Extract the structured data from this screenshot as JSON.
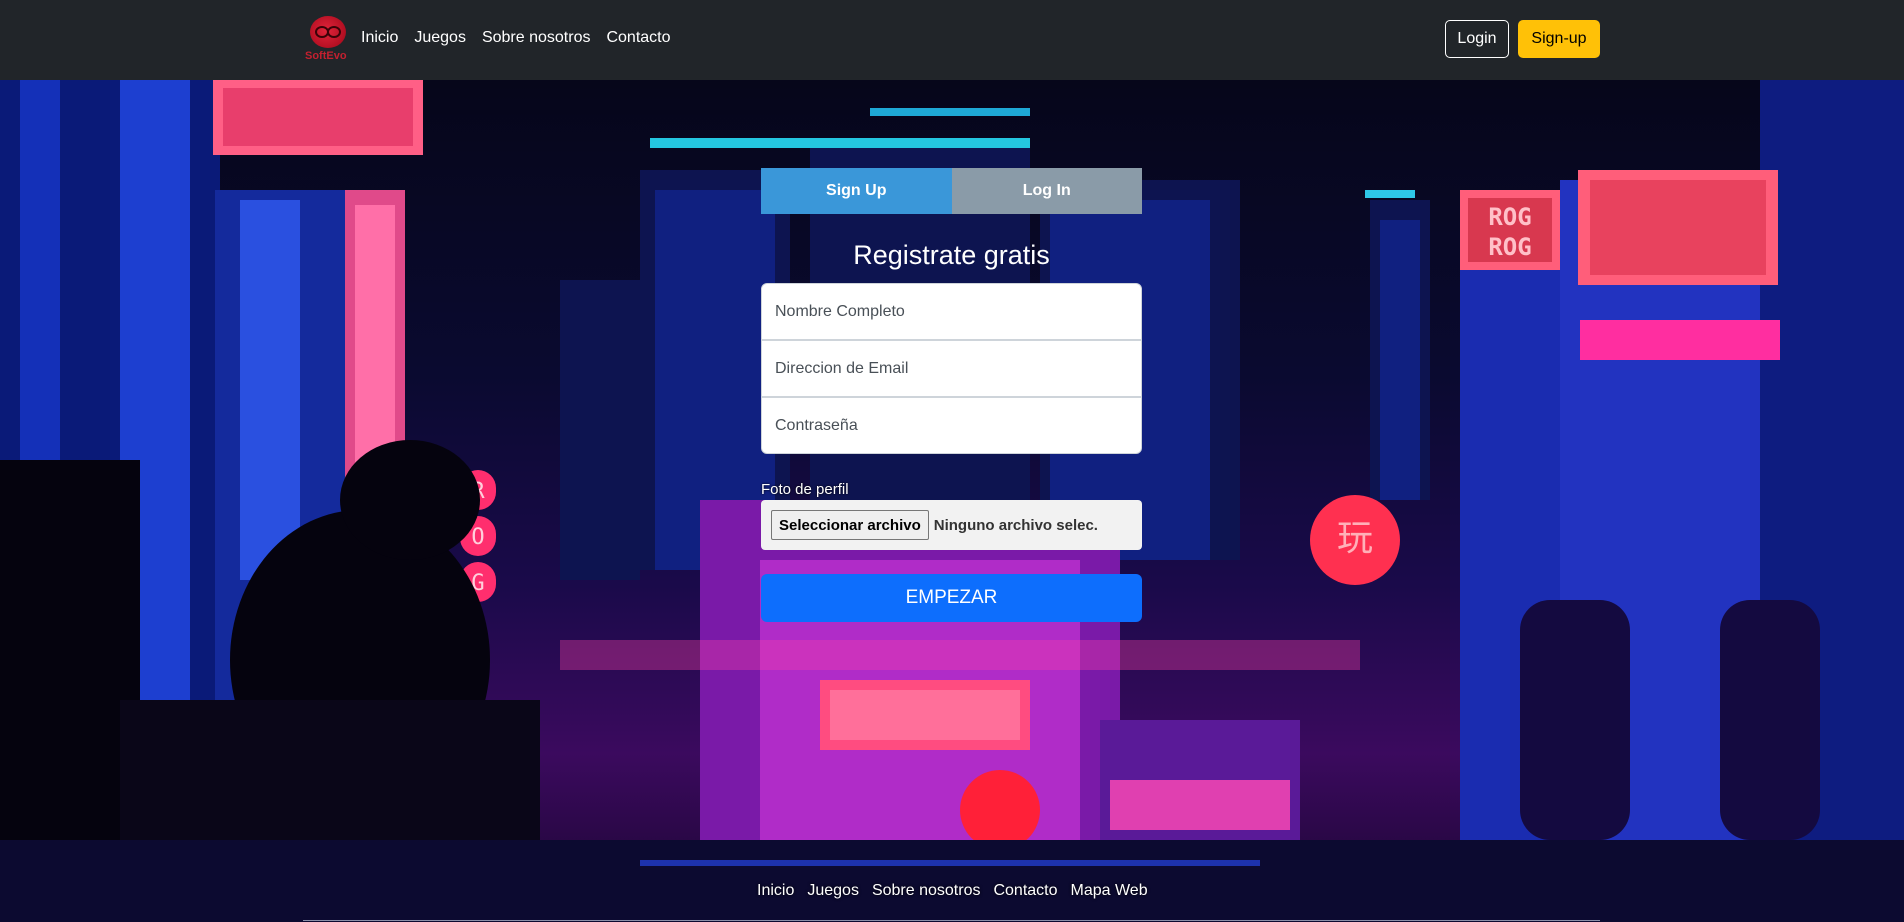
{
  "navbar": {
    "brand_name": "SoftEvo",
    "links": [
      "Inicio",
      "Juegos",
      "Sobre nosotros",
      "Contacto"
    ],
    "login_label": "Login",
    "signup_label": "Sign-up"
  },
  "form": {
    "tab_signup": "Sign Up",
    "tab_login": "Log In",
    "title": "Registrate gratis",
    "name_placeholder": "Nombre Completo",
    "email_placeholder": "Direccion de Email",
    "password_placeholder": "Contraseña",
    "photo_label": "Foto de perfil",
    "file_button": "Seleccionar archivo",
    "file_status": "Ninguno archivo selec.",
    "submit_label": "EMPEZAR"
  },
  "scene": {
    "signs": [
      "ROG",
      "ROG",
      "R",
      "O",
      "G",
      "玩"
    ]
  },
  "footer": {
    "links": [
      "Inicio",
      "Juegos",
      "Sobre nosotros",
      "Contacto",
      "Mapa Web"
    ]
  },
  "colors": {
    "navbar_bg": "#212529",
    "accent_yellow": "#ffc107",
    "primary_blue": "#0d6efd",
    "tab_active": "#3a97d9",
    "tab_inactive": "#8a9ba8",
    "neon_pink": "#ff3d8b",
    "neon_blue": "#1f3fd6"
  }
}
